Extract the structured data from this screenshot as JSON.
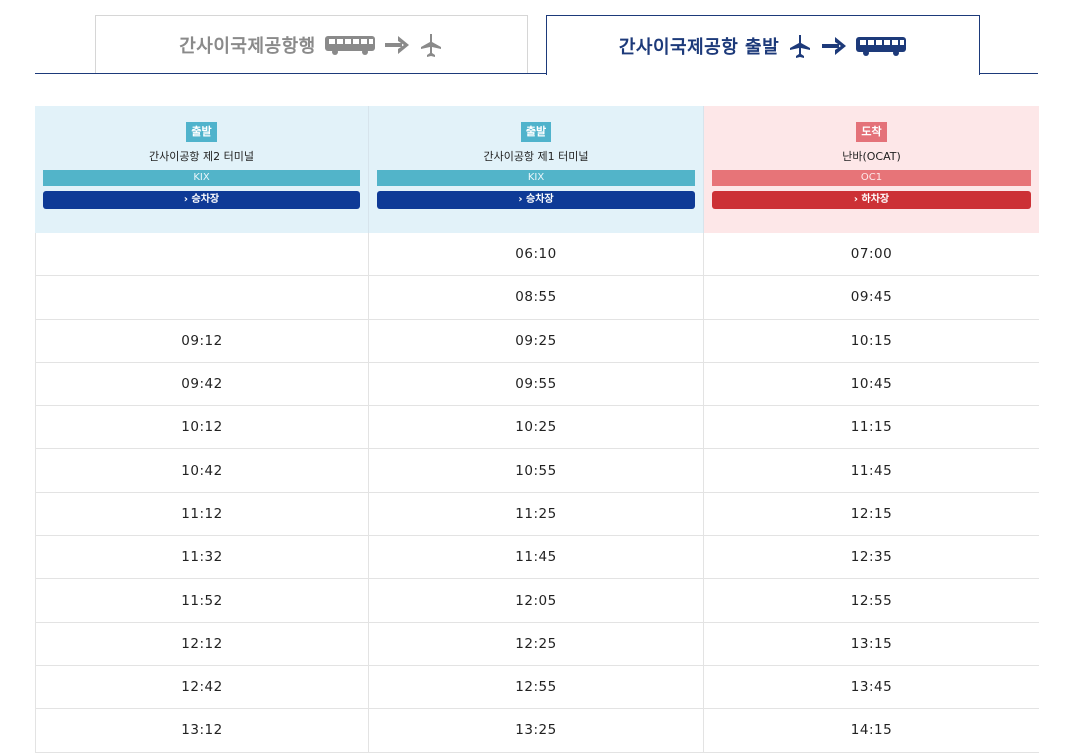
{
  "tabs": [
    {
      "label": "간사이국제공항행",
      "icons": [
        "bus-icon",
        "arrow-right-icon",
        "airplane-icon"
      ],
      "active": false
    },
    {
      "label": "간사이국제공항 출발",
      "icons": [
        "airplane-icon",
        "arrow-right-icon",
        "bus-icon"
      ],
      "active": true
    }
  ],
  "columns": [
    {
      "badge": "출발",
      "name": "간사이공항 제2 터미널",
      "code": "KIX",
      "button": "› 승차장",
      "type": "departure"
    },
    {
      "badge": "출발",
      "name": "간사이공항 제1 터미널",
      "code": "KIX",
      "button": "› 승차장",
      "type": "departure"
    },
    {
      "badge": "도착",
      "name": "난바(OCAT)",
      "code": "OC1",
      "button": "› 하차장",
      "type": "arrival"
    }
  ],
  "rows": [
    [
      "",
      "06:10",
      "07:00"
    ],
    [
      "",
      "08:55",
      "09:45"
    ],
    [
      "09:12",
      "09:25",
      "10:15"
    ],
    [
      "09:42",
      "09:55",
      "10:45"
    ],
    [
      "10:12",
      "10:25",
      "11:15"
    ],
    [
      "10:42",
      "10:55",
      "11:45"
    ],
    [
      "11:12",
      "11:25",
      "12:15"
    ],
    [
      "11:32",
      "11:45",
      "12:35"
    ],
    [
      "11:52",
      "12:05",
      "12:55"
    ],
    [
      "12:12",
      "12:25",
      "13:15"
    ],
    [
      "12:42",
      "12:55",
      "13:45"
    ],
    [
      "13:12",
      "13:25",
      "14:15"
    ]
  ],
  "colors": {
    "navy": "#1d3a7a",
    "departure_bg": "#e2f2f9",
    "arrival_bg": "#fde7e8",
    "button_blue": "#0e3a96",
    "button_red": "#cc3136"
  }
}
